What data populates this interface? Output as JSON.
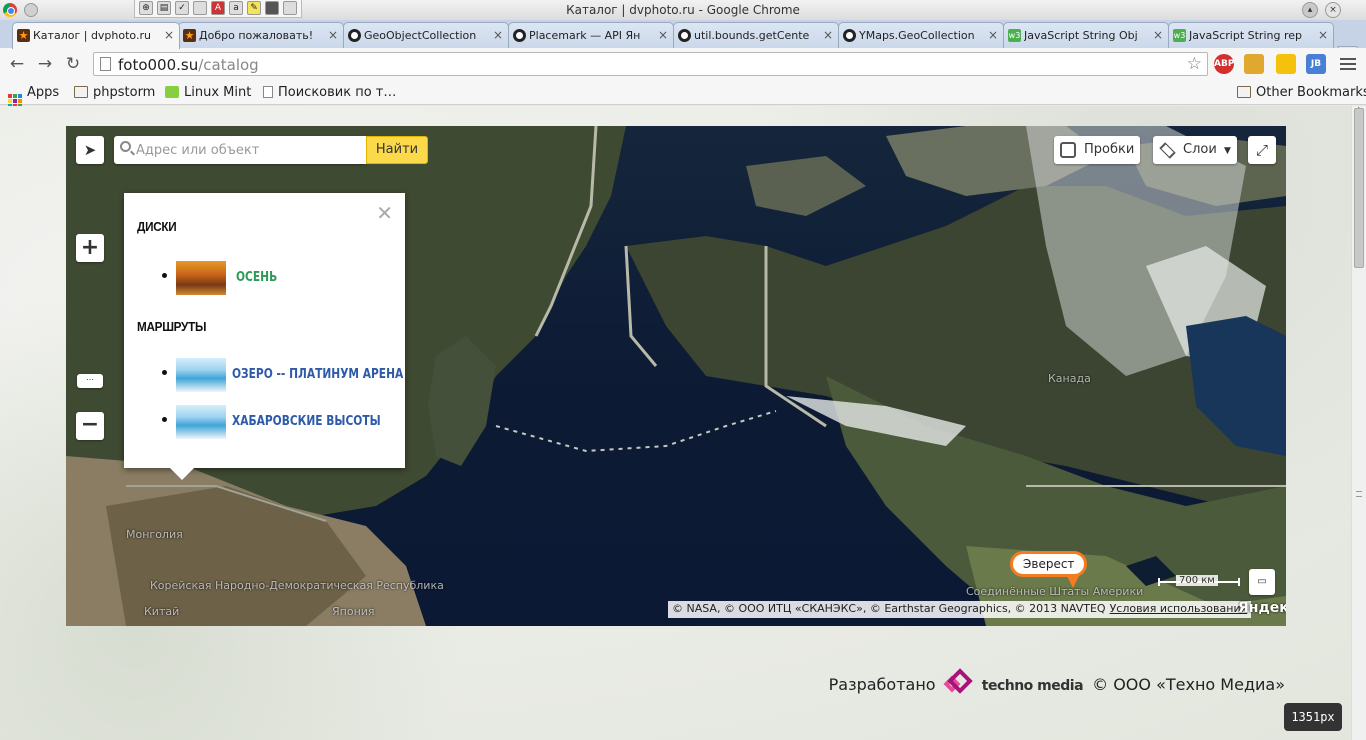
{
  "window": {
    "title": "Каталог | dvphoto.ru - Google Chrome",
    "controls": [
      "▴",
      "×"
    ]
  },
  "tabs": [
    {
      "label": "Каталог | dvphoto.ru",
      "icon": "star-favicon",
      "active": true
    },
    {
      "label": "Добро пожаловать!",
      "icon": "star-favicon"
    },
    {
      "label": "GeoObjectCollection",
      "icon": "ring-favicon"
    },
    {
      "label": "Placemark — API Ян",
      "icon": "ring-favicon"
    },
    {
      "label": "util.bounds.getCente",
      "icon": "ring-favicon"
    },
    {
      "label": "YMaps.GeoCollection",
      "icon": "ring-favicon"
    },
    {
      "label": "JavaScript String Obj",
      "icon": "w3-favicon"
    },
    {
      "label": "JavaScript String rep",
      "icon": "w3-favicon"
    }
  ],
  "address_bar": {
    "host": "foto000.su",
    "path": "/catalog"
  },
  "extensions": [
    "ABP",
    "JB"
  ],
  "bookmarks": {
    "items": [
      "Apps",
      "phpstorm",
      "Linux Mint",
      "Поисковик по т…"
    ],
    "other": "Other Bookmarks"
  },
  "map": {
    "search_placeholder": "Адрес или объект",
    "find_button": "Найти",
    "traffic_button": "Пробки",
    "layers_button": "Слои",
    "labels": {
      "mongolia": "Монголия",
      "north_korea": "Корейская Народно-Демократическая Республика",
      "china": "Китай",
      "japan": "Япония",
      "canada": "Канада",
      "usa": "Соединённые Штаты Америки"
    },
    "placemark": "Эверест",
    "scale": "700 км",
    "copyright": "© NASA, © ООО ИТЦ «СКАНЭКС», © Earthstar Geographics, © 2013 NAVTEQ",
    "terms": "Условия использования",
    "provider_logo": "Яндекс",
    "balloon": {
      "sections": [
        {
          "title": "ДИСКИ",
          "items": [
            {
              "label": "ОСЕНЬ",
              "color": "#2e9a5a",
              "thumb": "autumn"
            }
          ]
        },
        {
          "title": "МАРШРУТЫ",
          "items": [
            {
              "label": "ОЗЕРО -- ПЛАТИНУМ АРЕНА",
              "color": "#2e5aa8",
              "thumb": "lake"
            },
            {
              "label": "ХАБАРОВСКИЕ ВЫСОТЫ",
              "color": "#2e5aa8",
              "thumb": "lake"
            }
          ]
        }
      ]
    }
  },
  "footer": {
    "developed": "Разработано",
    "brand": "techno media",
    "company": "© ООО «Техно Медиа»"
  },
  "width_badge": "1351px",
  "colors": {
    "accent_button": "#fcd94a",
    "placemark_border": "#f47b20",
    "disk_link": "#2e9a5a",
    "route_link": "#2e5aa8"
  }
}
